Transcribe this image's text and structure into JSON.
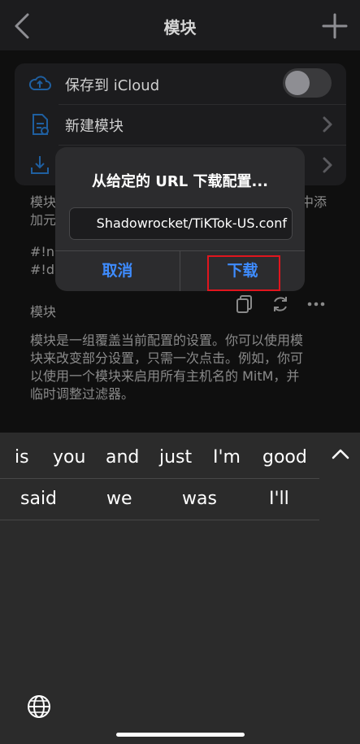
{
  "nav": {
    "title": "模块"
  },
  "rows": {
    "save_icloud": "保存到 iCloud",
    "new_module": "新建模块"
  },
  "background_text": {
    "desc_line1_left": "模块",
    "desc_line1_right": "中添",
    "desc_line2": "加元",
    "code1": "#!na",
    "code2": "#!de"
  },
  "section": {
    "title": "模块"
  },
  "description": {
    "line1": "模块是一组覆盖当前配置的设置。你可以使用模",
    "line2": "块来改变部分设置，只需一次点击。例如，你可",
    "line3": "以使用一个模块来启用所有主机名的 MitM，并",
    "line4": "临时调整过滤器。"
  },
  "dialog": {
    "title": "从给定的 URL 下载配置...",
    "input_value": "Shadowrocket/TiKTok-US.conf",
    "cancel_label": "取消",
    "download_label": "下载"
  },
  "keyboard": {
    "row1": [
      "is",
      "you",
      "and",
      "just",
      "I'm",
      "good"
    ],
    "row2": [
      "said",
      "we",
      "was",
      "I'll"
    ]
  },
  "colors": {
    "accent": "#3e8cff",
    "highlight": "#e0151e"
  }
}
